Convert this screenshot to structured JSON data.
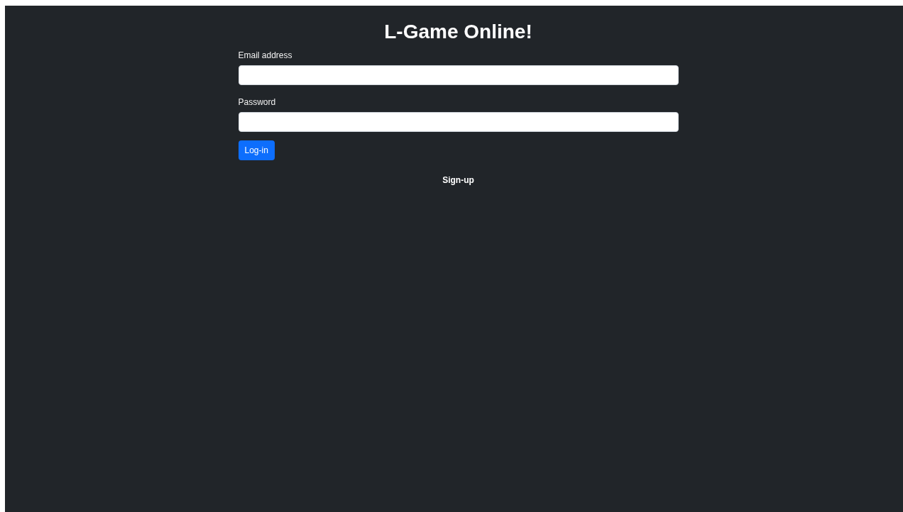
{
  "title": "L-Game Online!",
  "fields": [
    {
      "label": "Email address"
    },
    {
      "label": "Password"
    }
  ],
  "login_button": "Log-in",
  "signup_link": "Sign-up"
}
